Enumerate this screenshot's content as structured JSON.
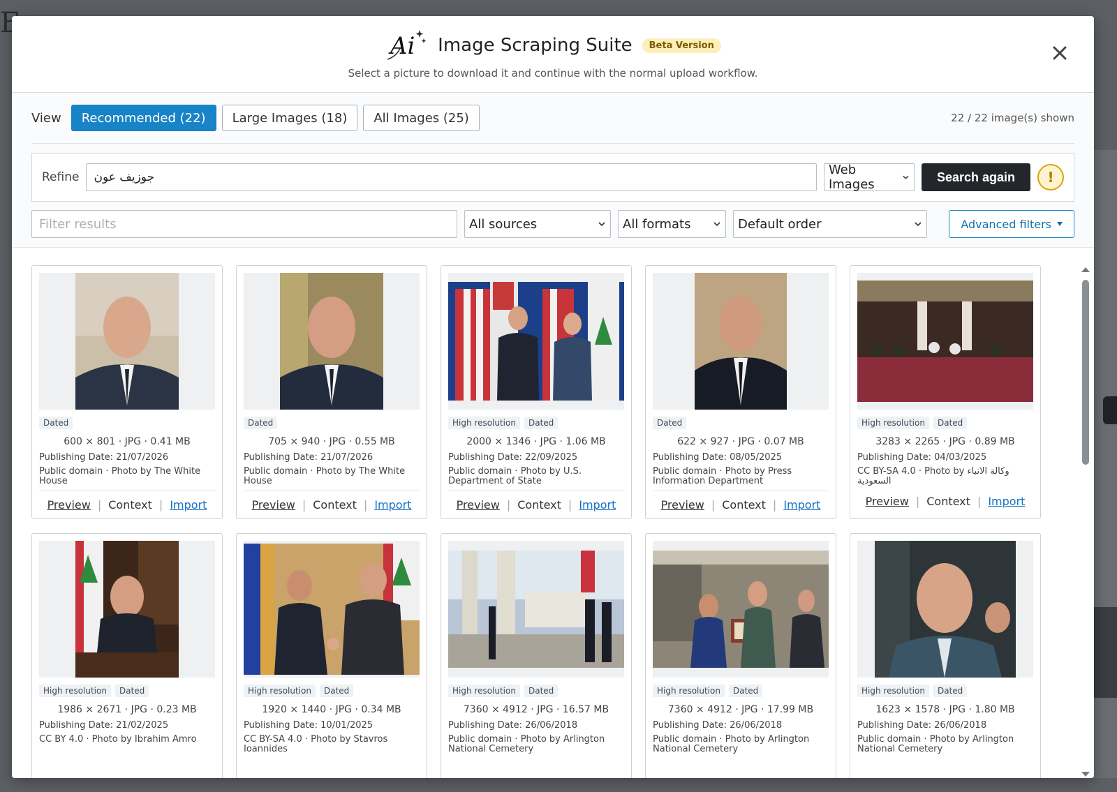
{
  "header": {
    "logo_text": "Ai",
    "title": "Image Scraping Suite",
    "badge": "Beta Version",
    "subtitle": "Select a picture to download it and continue with the normal upload workflow.",
    "close_icon": "close-icon"
  },
  "view": {
    "label": "View",
    "tabs": [
      {
        "label": "Recommended (22)",
        "active": true
      },
      {
        "label": "Large Images (18)",
        "active": false
      },
      {
        "label": "All Images (25)",
        "active": false
      }
    ],
    "count_text": "22 / 22 image(s) shown"
  },
  "refine": {
    "label": "Refine",
    "query": "جوزيف عون",
    "source_type": "Web Images",
    "search_label": "Search again",
    "warning_symbol": "!"
  },
  "filters": {
    "placeholder": "Filter results",
    "sources": "All sources",
    "formats": "All formats",
    "order": "Default order",
    "advanced_label": "Advanced filters"
  },
  "colors": {
    "accent": "#1883c6",
    "dark_button": "#23272c",
    "link": "#1370c8",
    "beta_bg": "#fdefb9",
    "warning": "#d9a40b"
  },
  "actions": {
    "preview": "Preview",
    "context": "Context",
    "import": "Import",
    "separator": "|"
  },
  "cards": [
    {
      "badges": [
        "Dated"
      ],
      "dims": "600 × 801 · JPG · 0.41 MB",
      "pub": "Publishing Date: 21/07/2026",
      "license": "Public domain · Photo by The White House"
    },
    {
      "badges": [
        "Dated"
      ],
      "dims": "705 × 940 · JPG · 0.55 MB",
      "pub": "Publishing Date: 21/07/2026",
      "license": "Public domain · Photo by The White House"
    },
    {
      "badges": [
        "High resolution",
        "Dated"
      ],
      "dims": "2000 × 1346 · JPG · 1.06 MB",
      "pub": "Publishing Date: 22/09/2025",
      "license": "Public domain · Photo by U.S. Department of State"
    },
    {
      "badges": [
        "Dated"
      ],
      "dims": "622 × 927 · JPG · 0.07 MB",
      "pub": "Publishing Date: 08/05/2025",
      "license": "Public domain · Photo by Press Information Department"
    },
    {
      "badges": [
        "High resolution",
        "Dated"
      ],
      "dims": "3283 × 2265 · JPG · 0.89 MB",
      "pub": "Publishing Date: 04/03/2025",
      "license": "CC BY-SA 4.0 · Photo by وكالة الأنباء السعودية"
    },
    {
      "badges": [
        "High resolution",
        "Dated"
      ],
      "dims": "1986 × 2671 · JPG · 0.23 MB",
      "pub": "Publishing Date: 21/02/2025",
      "license": "CC BY 4.0 · Photo by Ibrahim Amro"
    },
    {
      "badges": [
        "High resolution",
        "Dated"
      ],
      "dims": "1920 × 1440 · JPG · 0.34 MB",
      "pub": "Publishing Date: 10/01/2025",
      "license": "CC BY-SA 4.0 · Photo by Stavros Ioannides"
    },
    {
      "badges": [
        "High resolution",
        "Dated"
      ],
      "dims": "7360 × 4912 · JPG · 16.57 MB",
      "pub": "Publishing Date: 26/06/2018",
      "license": "Public domain · Photo by Arlington National Cemetery"
    },
    {
      "badges": [
        "High resolution",
        "Dated"
      ],
      "dims": "7360 × 4912 · JPG · 17.99 MB",
      "pub": "Publishing Date: 26/06/2018",
      "license": "Public domain · Photo by Arlington National Cemetery"
    },
    {
      "badges": [
        "High resolution",
        "Dated"
      ],
      "dims": "1623 × 1578 · JPG · 1.80 MB",
      "pub": "Publishing Date: 26/06/2018",
      "license": "Public domain · Photo by Arlington National Cemetery"
    }
  ]
}
